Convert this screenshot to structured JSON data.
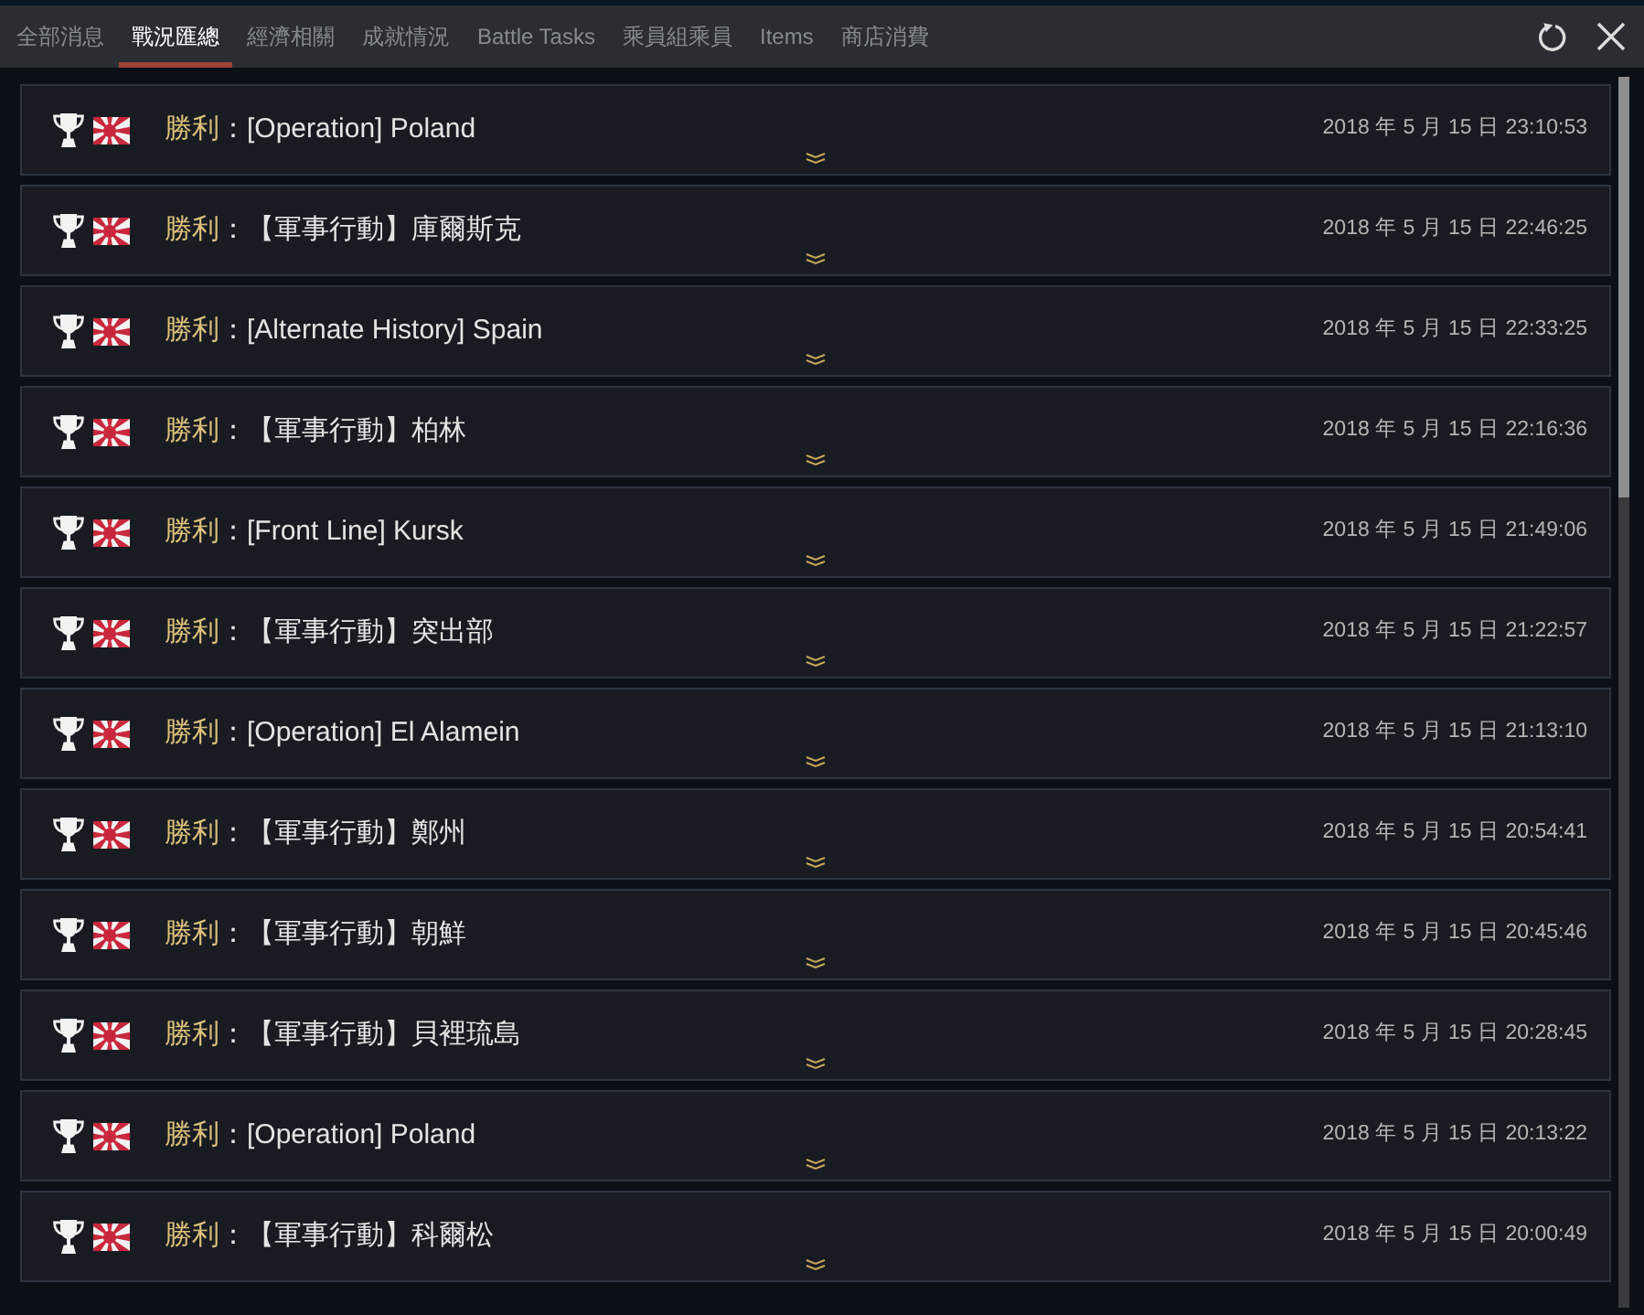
{
  "tabs": [
    {
      "label": "全部消息",
      "selected": false
    },
    {
      "label": "戰況匯總",
      "selected": true
    },
    {
      "label": "經濟相關",
      "selected": false
    },
    {
      "label": "成就情況",
      "selected": false
    },
    {
      "label": "Battle Tasks",
      "selected": false
    },
    {
      "label": "乘員組乘員",
      "selected": false
    },
    {
      "label": "Items",
      "selected": false
    },
    {
      "label": "商店消費",
      "selected": false
    }
  ],
  "messages": [
    {
      "result": "勝利",
      "separator": "：",
      "title": "[Operation] Poland",
      "time": "2018 年 5 月 15 日 23:10:53"
    },
    {
      "result": "勝利",
      "separator": "：",
      "title": "【軍事行動】庫爾斯克",
      "time": "2018 年 5 月 15 日 22:46:25"
    },
    {
      "result": "勝利",
      "separator": "：",
      "title": "[Alternate History] Spain",
      "time": "2018 年 5 月 15 日 22:33:25"
    },
    {
      "result": "勝利",
      "separator": "：",
      "title": "【軍事行動】柏林",
      "time": "2018 年 5 月 15 日 22:16:36"
    },
    {
      "result": "勝利",
      "separator": "：",
      "title": "[Front Line] Kursk",
      "time": "2018 年 5 月 15 日 21:49:06"
    },
    {
      "result": "勝利",
      "separator": "：",
      "title": "【軍事行動】突出部",
      "time": "2018 年 5 月 15 日 21:22:57"
    },
    {
      "result": "勝利",
      "separator": "：",
      "title": "[Operation] El Alamein",
      "time": "2018 年 5 月 15 日 21:13:10"
    },
    {
      "result": "勝利",
      "separator": "：",
      "title": "【軍事行動】鄭州",
      "time": "2018 年 5 月 15 日 20:54:41"
    },
    {
      "result": "勝利",
      "separator": "：",
      "title": "【軍事行動】朝鮮",
      "time": "2018 年 5 月 15 日 20:45:46"
    },
    {
      "result": "勝利",
      "separator": "：",
      "title": "【軍事行動】貝裡琉島",
      "time": "2018 年 5 月 15 日 20:28:45"
    },
    {
      "result": "勝利",
      "separator": "：",
      "title": "[Operation] Poland",
      "time": "2018 年 5 月 15 日 20:13:22"
    },
    {
      "result": "勝利",
      "separator": "：",
      "title": "【軍事行動】科爾松",
      "time": "2018 年 5 月 15 日 20:00:49"
    }
  ]
}
